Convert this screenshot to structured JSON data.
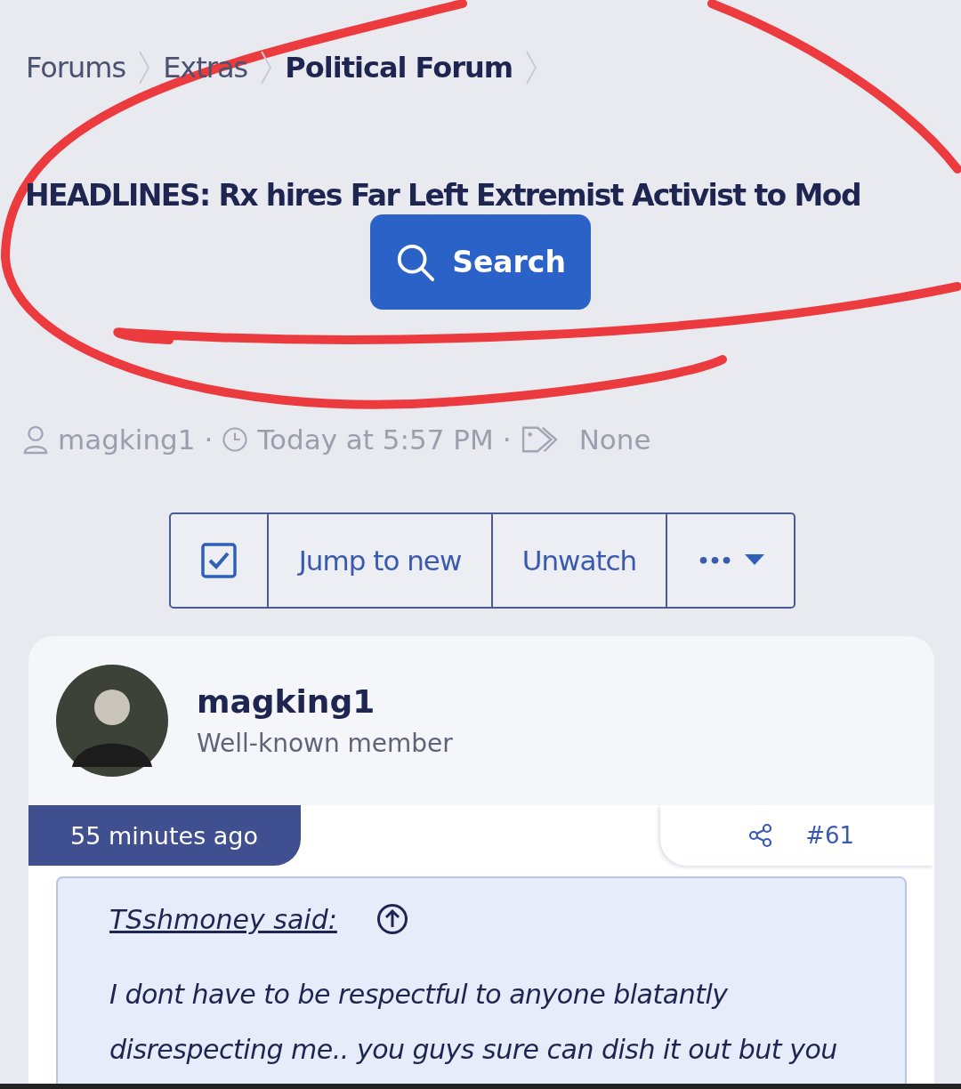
{
  "breadcrumbs": [
    {
      "label": "Forums",
      "current": false
    },
    {
      "label": "Extras",
      "current": false
    },
    {
      "label": "Political Forum",
      "current": true
    }
  ],
  "thread_title": "HEADLINES: Rx hires Far Left Extremist Activist to Mod",
  "search_button": "Search",
  "meta": {
    "author": "magking1",
    "separator_1": "·",
    "time": "Today at 5:57 PM",
    "separator_2": "·",
    "tags": "None"
  },
  "actions": [
    {
      "kind": "checkbox",
      "checked": true
    },
    {
      "kind": "text",
      "label": "Jump to new"
    },
    {
      "kind": "text",
      "label": "Unwatch"
    },
    {
      "kind": "more",
      "label": "•••"
    }
  ],
  "post": {
    "username": "magking1",
    "user_title": "Well-known member",
    "time": "55 minutes ago",
    "number": "#61",
    "quote": {
      "author": "TSshmoney said:",
      "text": "I dont have to be respectful to anyone blatantly disrespecting me.. you guys sure can dish it out but you"
    }
  }
}
